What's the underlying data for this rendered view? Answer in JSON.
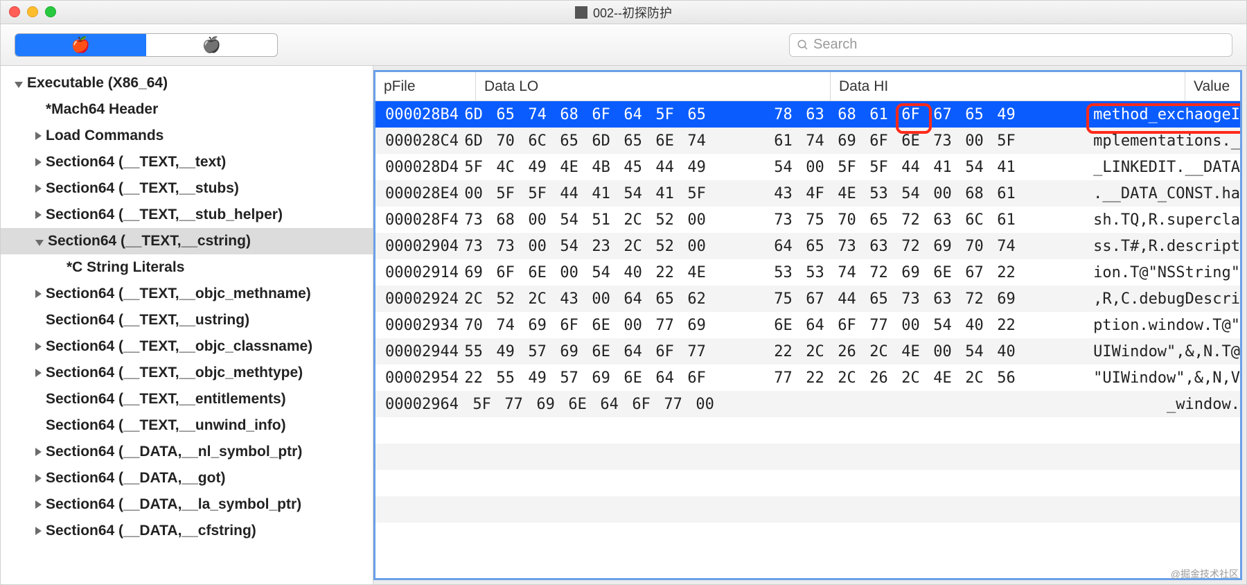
{
  "window": {
    "title": "002--初探防护"
  },
  "search": {
    "placeholder": "Search"
  },
  "watermark": "@掘金技术社区",
  "sidebar": {
    "items": [
      {
        "indent": 0,
        "disc": "open",
        "label": "Executable  (X86_64)",
        "sel": false
      },
      {
        "indent": 1,
        "disc": "none",
        "label": "*Mach64 Header",
        "sel": false
      },
      {
        "indent": 1,
        "disc": "closed",
        "label": "Load Commands",
        "sel": false
      },
      {
        "indent": 1,
        "disc": "closed",
        "label": "Section64 (__TEXT,__text)",
        "sel": false
      },
      {
        "indent": 1,
        "disc": "closed",
        "label": "Section64 (__TEXT,__stubs)",
        "sel": false
      },
      {
        "indent": 1,
        "disc": "closed",
        "label": "Section64 (__TEXT,__stub_helper)",
        "sel": false
      },
      {
        "indent": 1,
        "disc": "open",
        "label": "Section64 (__TEXT,__cstring)",
        "sel": true
      },
      {
        "indent": 2,
        "disc": "none",
        "label": "*C String Literals",
        "sel": false
      },
      {
        "indent": 1,
        "disc": "closed",
        "label": "Section64 (__TEXT,__objc_methname)",
        "sel": false
      },
      {
        "indent": 1,
        "disc": "none",
        "label": "Section64 (__TEXT,__ustring)",
        "sel": false
      },
      {
        "indent": 1,
        "disc": "closed",
        "label": "Section64 (__TEXT,__objc_classname)",
        "sel": false
      },
      {
        "indent": 1,
        "disc": "closed",
        "label": "Section64 (__TEXT,__objc_methtype)",
        "sel": false
      },
      {
        "indent": 1,
        "disc": "none",
        "label": "Section64 (__TEXT,__entitlements)",
        "sel": false
      },
      {
        "indent": 1,
        "disc": "none",
        "label": "Section64 (__TEXT,__unwind_info)",
        "sel": false
      },
      {
        "indent": 1,
        "disc": "closed",
        "label": "Section64 (__DATA,__nl_symbol_ptr)",
        "sel": false
      },
      {
        "indent": 1,
        "disc": "closed",
        "label": "Section64 (__DATA,__got)",
        "sel": false
      },
      {
        "indent": 1,
        "disc": "closed",
        "label": "Section64 (__DATA,__la_symbol_ptr)",
        "sel": false
      },
      {
        "indent": 1,
        "disc": "closed",
        "label": "Section64 (__DATA,__cfstring)",
        "sel": false
      }
    ]
  },
  "grid": {
    "headers": {
      "pfile": "pFile",
      "dlo": "Data LO",
      "dhi": "Data HI",
      "value": "Value"
    },
    "rows": [
      {
        "p": "000028B4",
        "lo": [
          "6D",
          "65",
          "74",
          "68",
          "6F",
          "64",
          "5F",
          "65"
        ],
        "hi": [
          "78",
          "63",
          "68",
          "61",
          "6F",
          "67",
          "65",
          "49"
        ],
        "val": "method_exchaogeI",
        "sel": true
      },
      {
        "p": "000028C4",
        "lo": [
          "6D",
          "70",
          "6C",
          "65",
          "6D",
          "65",
          "6E",
          "74"
        ],
        "hi": [
          "61",
          "74",
          "69",
          "6F",
          "6E",
          "73",
          "00",
          "5F"
        ],
        "val": "mplementations._"
      },
      {
        "p": "000028D4",
        "lo": [
          "5F",
          "4C",
          "49",
          "4E",
          "4B",
          "45",
          "44",
          "49"
        ],
        "hi": [
          "54",
          "00",
          "5F",
          "5F",
          "44",
          "41",
          "54",
          "41"
        ],
        "val": "_LINKEDIT.__DATA"
      },
      {
        "p": "000028E4",
        "lo": [
          "00",
          "5F",
          "5F",
          "44",
          "41",
          "54",
          "41",
          "5F"
        ],
        "hi": [
          "43",
          "4F",
          "4E",
          "53",
          "54",
          "00",
          "68",
          "61"
        ],
        "val": ".__DATA_CONST.ha"
      },
      {
        "p": "000028F4",
        "lo": [
          "73",
          "68",
          "00",
          "54",
          "51",
          "2C",
          "52",
          "00"
        ],
        "hi": [
          "73",
          "75",
          "70",
          "65",
          "72",
          "63",
          "6C",
          "61"
        ],
        "val": "sh.TQ,R.supercla"
      },
      {
        "p": "00002904",
        "lo": [
          "73",
          "73",
          "00",
          "54",
          "23",
          "2C",
          "52",
          "00"
        ],
        "hi": [
          "64",
          "65",
          "73",
          "63",
          "72",
          "69",
          "70",
          "74"
        ],
        "val": "ss.T#,R.descript"
      },
      {
        "p": "00002914",
        "lo": [
          "69",
          "6F",
          "6E",
          "00",
          "54",
          "40",
          "22",
          "4E"
        ],
        "hi": [
          "53",
          "53",
          "74",
          "72",
          "69",
          "6E",
          "67",
          "22"
        ],
        "val": "ion.T@\"NSString\""
      },
      {
        "p": "00002924",
        "lo": [
          "2C",
          "52",
          "2C",
          "43",
          "00",
          "64",
          "65",
          "62"
        ],
        "hi": [
          "75",
          "67",
          "44",
          "65",
          "73",
          "63",
          "72",
          "69"
        ],
        "val": ",R,C.debugDescri"
      },
      {
        "p": "00002934",
        "lo": [
          "70",
          "74",
          "69",
          "6F",
          "6E",
          "00",
          "77",
          "69"
        ],
        "hi": [
          "6E",
          "64",
          "6F",
          "77",
          "00",
          "54",
          "40",
          "22"
        ],
        "val": "ption.window.T@\""
      },
      {
        "p": "00002944",
        "lo": [
          "55",
          "49",
          "57",
          "69",
          "6E",
          "64",
          "6F",
          "77"
        ],
        "hi": [
          "22",
          "2C",
          "26",
          "2C",
          "4E",
          "00",
          "54",
          "40"
        ],
        "val": "UIWindow\",&,N.T@"
      },
      {
        "p": "00002954",
        "lo": [
          "22",
          "55",
          "49",
          "57",
          "69",
          "6E",
          "64",
          "6F"
        ],
        "hi": [
          "77",
          "22",
          "2C",
          "26",
          "2C",
          "4E",
          "2C",
          "56"
        ],
        "val": "\"UIWindow\",&,N,V"
      },
      {
        "p": "00002964",
        "lo": [
          "5F",
          "77",
          "69",
          "6E",
          "64",
          "6F",
          "77",
          "00"
        ],
        "hi": [
          "",
          "",
          "",
          "",
          "",
          "",
          "",
          ""
        ],
        "val": "_window."
      }
    ]
  }
}
